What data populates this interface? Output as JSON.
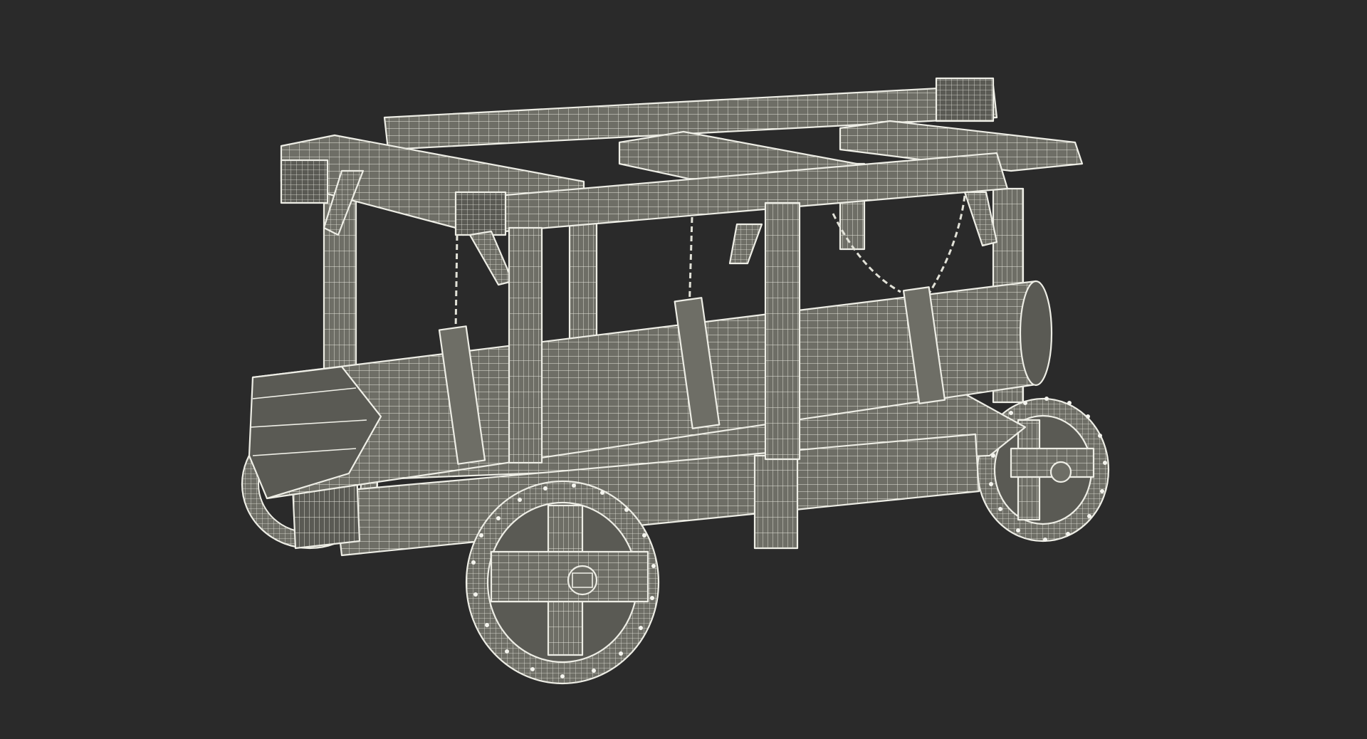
{
  "scene": {
    "subject": "battering-ram-wireframe",
    "render_style": "wireframe-on-clay",
    "colors": {
      "background": "#2a2a2a",
      "surface": "#6e6e66",
      "wire": "#eeeee6"
    }
  }
}
